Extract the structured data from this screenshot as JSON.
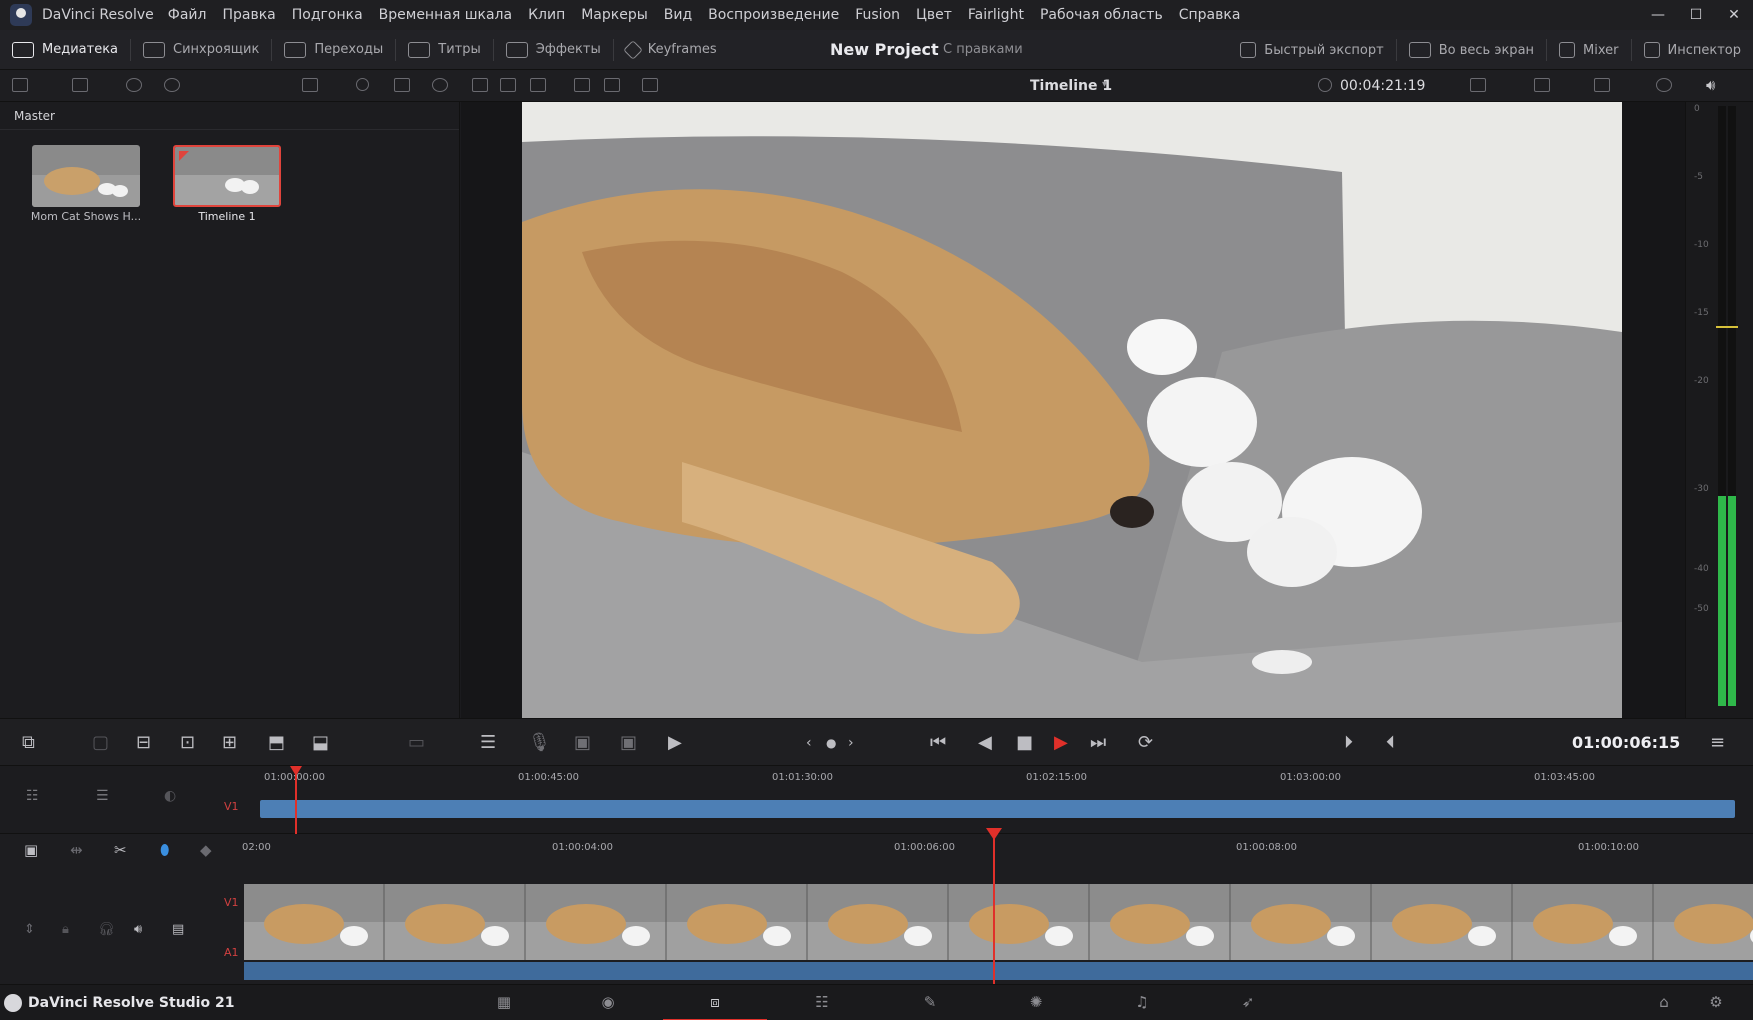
{
  "titlebar": {
    "app_name": "DaVinci Resolve",
    "menu": [
      "Файл",
      "Правка",
      "Подгонка",
      "Временная шкала",
      "Клип",
      "Маркеры",
      "Вид",
      "Воспроизведение",
      "Fusion",
      "Цвет",
      "Fairlight",
      "Рабочая область",
      "Справка"
    ],
    "minimize": "—",
    "maximize": "☐",
    "close": "✕"
  },
  "toolbar": {
    "media": "Медиатека",
    "sync": "Синхроящик",
    "transitions": "Переходы",
    "titles": "Титры",
    "effects": "Эффекты",
    "keyframes": "Keyframes",
    "project_title": "New Project",
    "project_sub": "С правками",
    "quick_export": "Быстрый экспорт",
    "fullscreen": "Во весь экран",
    "mixer": "Mixer",
    "inspector": "Инспектор"
  },
  "viewer_bar": {
    "timeline_name": "Timeline 1",
    "duration": "00:04:21:19"
  },
  "pool": {
    "header": "Master",
    "items": [
      {
        "label": "Mom Cat Shows H..."
      },
      {
        "label": "Timeline 1"
      }
    ]
  },
  "meter": {
    "ticks": [
      "0",
      "-5",
      "-10",
      "-15",
      "-20",
      "-30",
      "-40",
      "-50"
    ],
    "level": 0.35
  },
  "transport": {
    "timecode": "01:00:06:15"
  },
  "upper_timeline": {
    "track": "V1",
    "ruler": [
      "01:00:00:00",
      "01:00:45:00",
      "01:01:30:00",
      "01:02:15:00",
      "01:03:00:00",
      "01:03:45:00"
    ]
  },
  "lower_timeline": {
    "video_track": "V1",
    "audio_track": "A1",
    "ruler": [
      "02:00",
      "01:00:04:00",
      "01:00:06:00",
      "01:00:08:00",
      "01:00:10:00"
    ]
  },
  "pagebar": {
    "brand": "DaVinci Resolve Studio 21"
  },
  "colors": {
    "accent": "#e0302a",
    "clip_blue": "#4d7fb5",
    "meter_green": "#2fb84a"
  }
}
